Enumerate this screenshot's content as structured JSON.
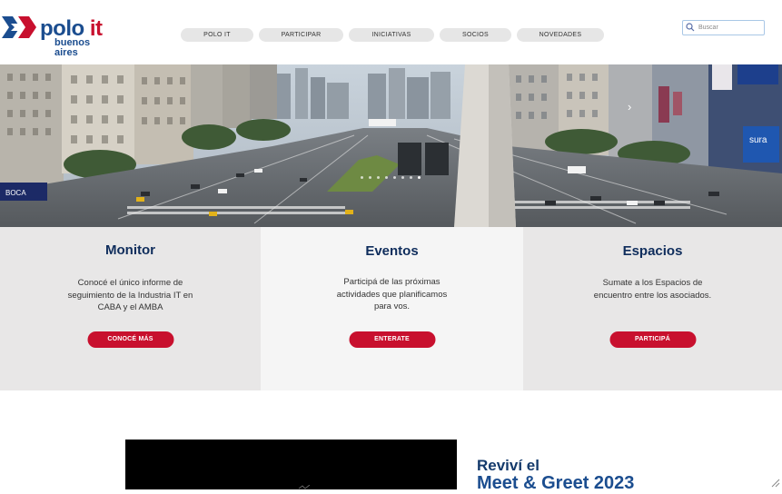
{
  "brand": {
    "name_main": "polo",
    "name_it": "it",
    "name_sub": "buenos aires"
  },
  "nav": {
    "items": [
      {
        "label": "POLO IT"
      },
      {
        "label": "PARTICIPAR"
      },
      {
        "label": "INICIATIVAS"
      },
      {
        "label": "SOCIOS"
      },
      {
        "label": "NOVEDADES"
      }
    ]
  },
  "search": {
    "placeholder": "Buscar",
    "icon": "search-icon"
  },
  "hero": {
    "storefront_sign": "BOCA",
    "building_sign": "sura",
    "arrow_icon": "chevron-right-icon"
  },
  "cards": [
    {
      "title": "Monitor",
      "text": "Conocé el único informe de\nseguimiento de la Industria IT en\nCABA y el AMBA",
      "button": "CONOCÉ MÁS"
    },
    {
      "title": "Eventos",
      "text": "Participá de las próximas\nactividades que planificamos\npara vos.",
      "button": "ENTERATE"
    },
    {
      "title": "Espacios",
      "text": "Sumate a los Espacios de\nencuentro entre los asociados.",
      "button": "PARTICIPÁ"
    }
  ],
  "promo": {
    "line1": "Reviví el",
    "line2": "Meet & Greet 2023"
  },
  "colors": {
    "brand_blue": "#1b4d8f",
    "brand_red": "#c8102e",
    "card_gray": "#e8e7e7",
    "card_light": "#f5f5f5"
  }
}
